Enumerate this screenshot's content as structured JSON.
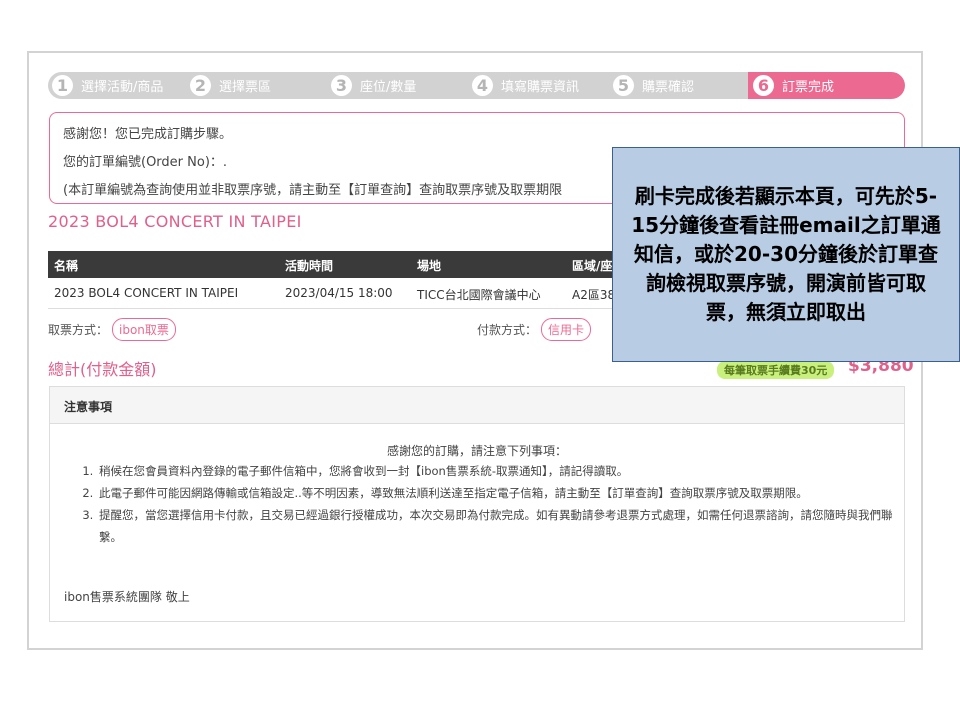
{
  "steps": [
    {
      "num": "1",
      "label": "選擇活動/商品"
    },
    {
      "num": "2",
      "label": "選擇票區"
    },
    {
      "num": "3",
      "label": "座位/數量"
    },
    {
      "num": "4",
      "label": "填寫購票資訊"
    },
    {
      "num": "5",
      "label": "購票確認"
    },
    {
      "num": "6",
      "label": "訂票完成",
      "active": true
    }
  ],
  "notice": {
    "line1": "感謝您！您已完成訂購步驟。",
    "line2": "您的訂單編號(Order No)：.",
    "line3": "(本訂單編號為查詢使用並非取票序號，請主動至【訂單查詢】查詢取票序號及取票期限"
  },
  "event_title": "2023 BOL4 CONCERT IN TAIPEI",
  "table": {
    "headers": [
      "名稱",
      "活動時間",
      "場地",
      "區域/座"
    ],
    "row": [
      "2023 BOL4 CONCERT IN TAIPEI",
      "2023/04/15 18:00",
      "TICC台北國際會議中心",
      "A2區38"
    ]
  },
  "pickup": {
    "label": "取票方式：",
    "value": "ibon取票"
  },
  "payment": {
    "label": "付款方式：",
    "value": "信用卡"
  },
  "total": {
    "label": "總計(付款金額)",
    "fee_note": "每筆取票手續費30元",
    "amount": "$3,880"
  },
  "notes": {
    "title": "注意事項",
    "intro": "感謝您的訂購，請注意下列事項：",
    "items": [
      "稍候在您會員資料內登錄的電子郵件信箱中，您將會收到一封【ibon售票系統-取票通知】，請記得讀取。",
      "此電子郵件可能因網路傳輸或信箱設定..等不明因素，導致無法順利送達至指定電子信箱，請主動至【訂單查詢】查詢取票序號及取票期限。",
      "提醒您，當您選擇信用卡付款，且交易已經過銀行授權成功，本次交易即為付款完成。如有異動請參考退票方式處理，如需任何退票諮詢，請您隨時與我們聯繫。"
    ],
    "signoff": "ibon售票系統團隊  敬上"
  },
  "callout": "刷卡完成後若顯示本頁，可先於5-15分鐘後查看註冊email之訂單通知信，或於20-30分鐘後於訂單查詢檢視取票序號，開演前皆可取票，無須立即取出",
  "colors": {
    "accent": "#ec6a92",
    "header_dark": "#3a3a3a",
    "callout_bg": "#b8cce4",
    "fee_badge": "#c9f07d"
  }
}
